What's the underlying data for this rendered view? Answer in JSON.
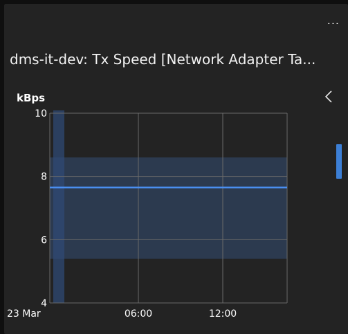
{
  "widget": {
    "menu_label": "...",
    "title": "dms-it-dev: Tx Speed [Network Adapter Ta...",
    "unit": "kBps",
    "collapse_icon": "chevron-left-icon"
  },
  "colors": {
    "background": "#232323",
    "series": "#4a8ef0",
    "band": "#2c3a4f",
    "highlight": "#2f4a74",
    "grid": "#6a6a6a"
  },
  "chart_data": {
    "type": "line",
    "title": "",
    "xlabel": "",
    "ylabel": "kBps",
    "x_ticks": [
      "23 Mar",
      "06:00",
      "12:00"
    ],
    "y_ticks": [
      "4",
      "6",
      "8",
      "10"
    ],
    "ylim": [
      4,
      10
    ],
    "series": [
      {
        "x": [
          "23 Mar 00:00",
          "23 Mar 17:00"
        ],
        "values": [
          7.65,
          7.65
        ]
      }
    ],
    "band": {
      "low": 5.4,
      "high": 8.6
    },
    "grid": true,
    "legend": "none"
  }
}
